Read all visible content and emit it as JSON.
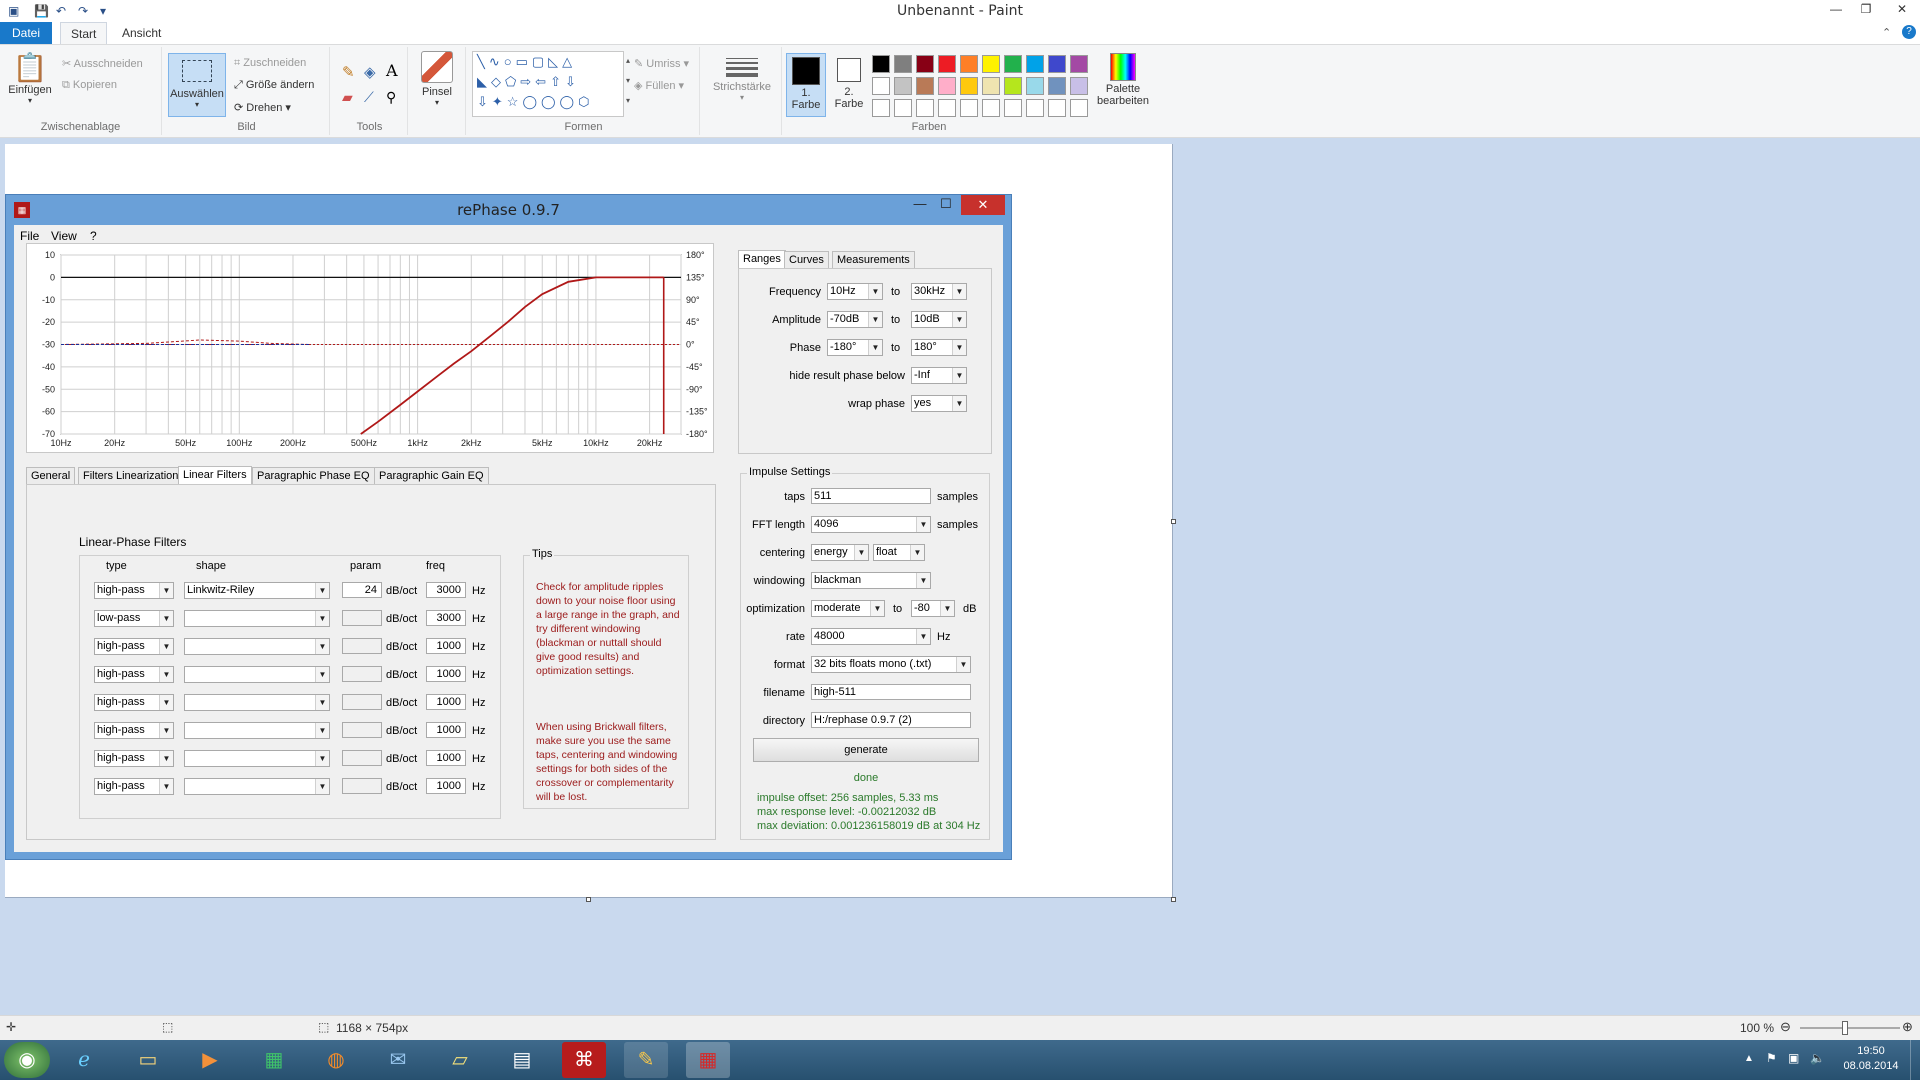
{
  "paint": {
    "window_title": "Unbenannt - Paint",
    "tabs": {
      "file": "Datei",
      "start": "Start",
      "view": "Ansicht"
    },
    "clipboard": {
      "paste": "Einfügen",
      "cut": "Ausschneiden",
      "copy": "Kopieren",
      "group": "Zwischenablage"
    },
    "image": {
      "select": "Auswählen",
      "crop": "Zuschneiden",
      "resize": "Größe ändern",
      "rotate": "Drehen",
      "group": "Bild"
    },
    "tools": {
      "group": "Tools"
    },
    "brushes": {
      "label": "Pinsel"
    },
    "shapes": {
      "outline": "Umriss",
      "fill": "Füllen",
      "group": "Formen"
    },
    "size": {
      "label": "Strichstärke"
    },
    "colors": {
      "color1": "1.\nFarbe",
      "color1_a": "1.",
      "color1_b": "Farbe",
      "color2_a": "2.",
      "color2_b": "Farbe",
      "edit_a": "Palette",
      "edit_b": "bearbeiten",
      "group": "Farben",
      "palette_row1": [
        "#000000",
        "#7f7f7f",
        "#880015",
        "#ed1c24",
        "#ff7f27",
        "#fff200",
        "#22b14c",
        "#00a2e8",
        "#3f48cc",
        "#a349a4"
      ],
      "palette_row2": [
        "#ffffff",
        "#c3c3c3",
        "#b97a57",
        "#ffaec9",
        "#ffc90e",
        "#efe4b0",
        "#b5e61d",
        "#99d9ea",
        "#7092be",
        "#c8bfe7"
      ]
    },
    "status": {
      "size": "1168 × 754px",
      "zoom": "100 %"
    },
    "taskbar": {
      "time": "19:50",
      "date": "08.08.2014"
    }
  },
  "rephase": {
    "title": "rePhase 0.9.7",
    "menu": {
      "file": "File",
      "view": "View",
      "help": "?"
    },
    "chart_data": {
      "type": "line",
      "title": "",
      "xscale": "log",
      "x_ticks": [
        "10Hz",
        "20Hz",
        "50Hz",
        "100Hz",
        "200Hz",
        "500Hz",
        "1kHz",
        "2kHz",
        "5kHz",
        "10kHz",
        "20kHz"
      ],
      "y_left_ticks": [
        "10",
        "0",
        "-10",
        "-20",
        "-30",
        "-40",
        "-50",
        "-60",
        "-70"
      ],
      "y_right_ticks": [
        "180°",
        "135°",
        "90°",
        "45°",
        "0°",
        "-45°",
        "-90°",
        "-135°",
        "-180°"
      ],
      "ylim": [
        -70,
        10
      ],
      "xlim": [
        10,
        30000
      ],
      "series": [
        {
          "color": "#b01818",
          "x": [
            480,
            600,
            800,
            1000,
            1300,
            1600,
            2000,
            2600,
            3200,
            4000,
            5000,
            7000,
            10000,
            20000,
            24000
          ],
          "values": [
            -70,
            -64.5,
            -57,
            -51,
            -44,
            -38.5,
            -33,
            -25.8,
            -20,
            -13.2,
            -7.5,
            -2,
            0,
            0,
            0
          ]
        },
        {
          "color": "#b01818",
          "x": [
            10,
            30,
            60,
            100,
            150,
            250
          ],
          "values": [
            -30,
            -29.5,
            -28,
            -28.5,
            -29.5,
            -30
          ]
        },
        {
          "color": "#1b2f9a",
          "x": [
            10,
            250
          ],
          "values": [
            -30,
            -30
          ]
        }
      ]
    },
    "main_tabs": [
      "General",
      "Filters Linearization",
      "Linear Filters",
      "Paragraphic Phase EQ",
      "Paragraphic Gain EQ"
    ],
    "linear_filters": {
      "title": "Linear-Phase Filters",
      "col_type": "type",
      "col_shape": "shape",
      "col_param": "param",
      "col_freq": "freq",
      "unit_param": "dB/oct",
      "unit_freq": "Hz",
      "rows": [
        {
          "type": "high-pass",
          "shape": "Linkwitz-Riley",
          "param": "24",
          "freq": "3000"
        },
        {
          "type": "low-pass",
          "shape": "",
          "param": "",
          "freq": "3000"
        },
        {
          "type": "high-pass",
          "shape": "",
          "param": "",
          "freq": "1000"
        },
        {
          "type": "high-pass",
          "shape": "",
          "param": "",
          "freq": "1000"
        },
        {
          "type": "high-pass",
          "shape": "",
          "param": "",
          "freq": "1000"
        },
        {
          "type": "high-pass",
          "shape": "",
          "param": "",
          "freq": "1000"
        },
        {
          "type": "high-pass",
          "shape": "",
          "param": "",
          "freq": "1000"
        },
        {
          "type": "high-pass",
          "shape": "",
          "param": "",
          "freq": "1000"
        }
      ]
    },
    "tips": {
      "title": "Tips",
      "p1": "Check for amplitude ripples down to your noise floor using a large range in the graph, and try different windowing (blackman or nuttall should give good results) and optimization settings.",
      "p2": "When using Brickwall filters, make sure you use the same taps, centering and windowing settings for both sides of the crossover or complementarity will be lost."
    },
    "range_tabs": [
      "Ranges",
      "Curves",
      "Measurements"
    ],
    "ranges": {
      "frequency": "Frequency",
      "freq_from": "10Hz",
      "freq_to": "30kHz",
      "amplitude": "Amplitude",
      "amp_from": "-70dB",
      "amp_to": "10dB",
      "phase": "Phase",
      "phase_from": "-180°",
      "phase_to": "180°",
      "to": "to",
      "hide_label": "hide result phase below",
      "hide_value": "-Inf",
      "wrap_label": "wrap phase",
      "wrap_value": "yes"
    },
    "impulse": {
      "title": "Impulse Settings",
      "taps_label": "taps",
      "taps": "511",
      "samples": "samples",
      "fft_label": "FFT length",
      "fft": "4096",
      "centering_label": "centering",
      "centering": "energy",
      "centering2": "float",
      "windowing_label": "windowing",
      "windowing": "blackman",
      "optimization_label": "optimization",
      "optimization": "moderate",
      "opt_to": "to",
      "opt_db": "-80",
      "db": "dB",
      "rate_label": "rate",
      "rate": "48000",
      "hz": "Hz",
      "format_label": "format",
      "format": "32 bits floats mono (.txt)",
      "filename_label": "filename",
      "filename": "high-511",
      "directory_label": "directory",
      "directory": "H:/rephase 0.9.7 (2)",
      "generate": "generate",
      "done": "done",
      "result1": "impulse offset: 256 samples, 5.33 ms",
      "result2": "max response level: -0.00212032 dB",
      "result3": "max deviation: 0.001236158019 dB at 304 Hz"
    }
  }
}
